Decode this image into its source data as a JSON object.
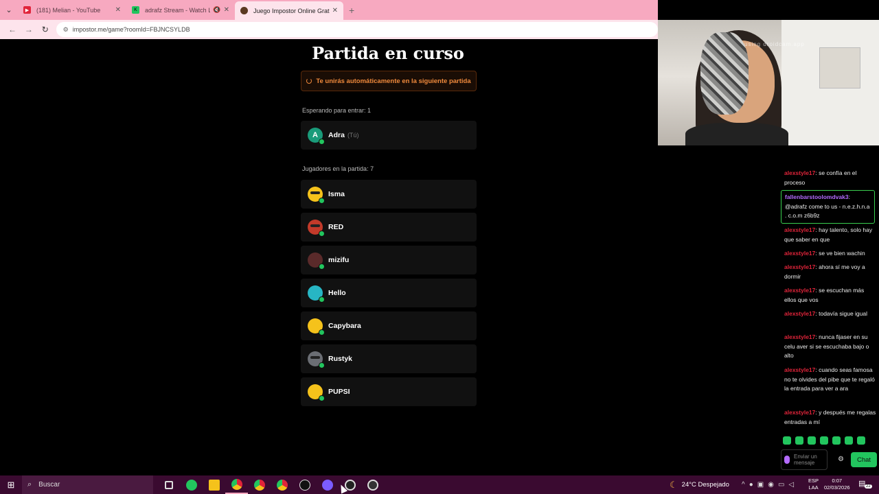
{
  "browser": {
    "tabs": [
      {
        "title": "(181) Melian - YouTube",
        "favicon": "youtube-icon",
        "color": "#e0243a"
      },
      {
        "title": "adrafz Stream - Watch Live",
        "favicon": "kick-icon",
        "color": "#22c55e",
        "muted": true
      },
      {
        "title": "Juego Impostor Online Gratis",
        "favicon": "impostor-icon",
        "color": "#5a3a22",
        "active": true
      }
    ],
    "url": "impostor.me/game?roomId=FBJNCSYLDB"
  },
  "game": {
    "title": "Partida en curso",
    "notice": "Te unirás automáticamente en la siguiente partida",
    "waiting_label": "Esperando para entrar: 1",
    "waiting": [
      {
        "name": "Adra",
        "tag": "(Tú)",
        "initial": "A",
        "color": "#1a9b7a"
      }
    ],
    "players_label": "Jugadores en la partida: 7",
    "players": [
      {
        "name": "Isma",
        "color": "#f5c21b"
      },
      {
        "name": "RED",
        "color": "#c23a2a"
      },
      {
        "name": "mizifu",
        "color": "#5a2a2a"
      },
      {
        "name": "Hello",
        "color": "#27b6c4"
      },
      {
        "name": "Capybara",
        "color": "#f5c21b"
      },
      {
        "name": "Rustyk",
        "color": "#6b6e74"
      },
      {
        "name": "PUPSI",
        "color": "#f5c21b"
      }
    ]
  },
  "webcam": {
    "watermark": "using droidcam.app"
  },
  "chat": {
    "messages": [
      {
        "user": "alexstyle17",
        "text": "se confía en el proceso"
      },
      {
        "user": "fallenbarstoolomdvak3",
        "text": "@adrafz come to us - n.e.z.h.n.a . c.o.m z6b9z",
        "highlight": true
      },
      {
        "user": "alexstyle17",
        "text": "hay talento, solo hay que saber en que"
      },
      {
        "user": "alexstyle17",
        "text": "se ve bien wachin"
      },
      {
        "user": "alexstyle17",
        "text": "ahora sí me voy a dormir"
      },
      {
        "user": "alexstyle17",
        "text": "se escuchan más ellos que vos"
      },
      {
        "user": "alexstyle17",
        "text": "todavía sigue igual"
      },
      {
        "user": "alexstyle17",
        "text": "nunca fijaser en su celu aver si se escuchaba bajo o alto"
      },
      {
        "user": "alexstyle17",
        "text": "cuando seas famosa no te olvides del pibe que te regaló la entrada para ver a ara"
      },
      {
        "user": "alexstyle17",
        "text": "y después me regalas entradas a mí"
      }
    ],
    "input_placeholder": "Enviar un mensaje",
    "send_label": "Chat"
  },
  "taskbar": {
    "search_placeholder": "Buscar",
    "weather": "24°C Despejado",
    "lang_line1": "ESP",
    "lang_line2": "LAA",
    "time": "0:07",
    "date": "02/03/2026",
    "notifications": "22"
  }
}
